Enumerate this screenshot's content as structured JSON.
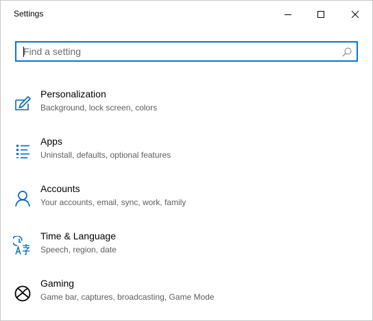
{
  "window": {
    "title": "Settings",
    "minimize_icon": "minimize-icon",
    "maximize_icon": "maximize-icon",
    "close_icon": "close-icon"
  },
  "search": {
    "placeholder": "Find a setting",
    "value": "",
    "icon": "search-icon"
  },
  "colors": {
    "accent": "#0078d4",
    "text": "#000000",
    "secondary_text": "#5d5d5d"
  },
  "categories": [
    {
      "label": "Personalization",
      "description": "Background, lock screen, colors",
      "icon": "personalization-icon"
    },
    {
      "label": "Apps",
      "description": "Uninstall, defaults, optional features",
      "icon": "apps-icon"
    },
    {
      "label": "Accounts",
      "description": "Your accounts, email, sync, work, family",
      "icon": "accounts-icon"
    },
    {
      "label": "Time & Language",
      "description": "Speech, region, date",
      "icon": "time-language-icon"
    },
    {
      "label": "Gaming",
      "description": "Game bar, captures, broadcasting, Game Mode",
      "icon": "gaming-icon"
    }
  ]
}
